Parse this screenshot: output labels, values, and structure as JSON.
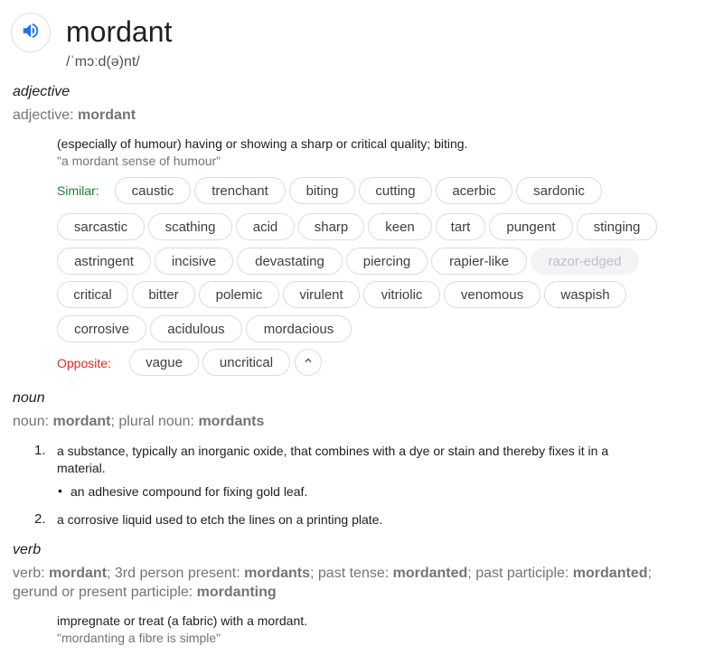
{
  "headword": "mordant",
  "phonetic": "/ˈmɔːd(ə)nt/",
  "adjective": {
    "pos_label": "adjective",
    "forms_prefix": "adjective: ",
    "forms_value": "mordant",
    "definition": "(especially of humour) having or showing a sharp or critical quality; biting.",
    "example": "\"a mordant sense of humour\"",
    "similar_label": "Similar:",
    "opposite_label": "Opposite:",
    "similar": [
      "caustic",
      "trenchant",
      "biting",
      "cutting",
      "acerbic",
      "sardonic",
      "sarcastic",
      "scathing",
      "acid",
      "sharp",
      "keen",
      "tart",
      "pungent",
      "stinging",
      "astringent",
      "incisive",
      "devastating",
      "piercing",
      "rapier-like",
      "razor-edged",
      "critical",
      "bitter",
      "polemic",
      "virulent",
      "vitriolic",
      "venomous",
      "waspish",
      "corrosive",
      "acidulous",
      "mordacious"
    ],
    "opposite": [
      "vague",
      "uncritical"
    ]
  },
  "noun": {
    "pos_label": "noun",
    "forms": {
      "a": "noun: ",
      "b": "mordant",
      "c": "; plural noun: ",
      "d": "mordants"
    },
    "senses": [
      {
        "num": "1.",
        "line1": "a substance, typically an inorganic oxide, that combines with a dye or stain and thereby fixes it in a",
        "line2": "material."
      },
      {
        "num": "2.",
        "line1": "a corrosive liquid used to etch the lines on a printing plate."
      }
    ],
    "subsense": "an adhesive compound for fixing gold leaf."
  },
  "verb": {
    "pos_label": "verb",
    "forms": {
      "a": "verb: ",
      "b": "mordant",
      "c": "; 3rd person present: ",
      "d": "mordants",
      "e": "; past tense: ",
      "f": "mordanted",
      "g": "; past participle: ",
      "h": "mordanted",
      "i": ";",
      "j": "gerund or present participle: ",
      "k": "mordanting"
    },
    "definition": "impregnate or treat (a fabric) with a mordant.",
    "example": "\"mordanting a fibre is simple\""
  },
  "colors": {
    "similar_label": "#188038",
    "opposite_label": "#d93025",
    "speaker": "#1a73e8"
  }
}
